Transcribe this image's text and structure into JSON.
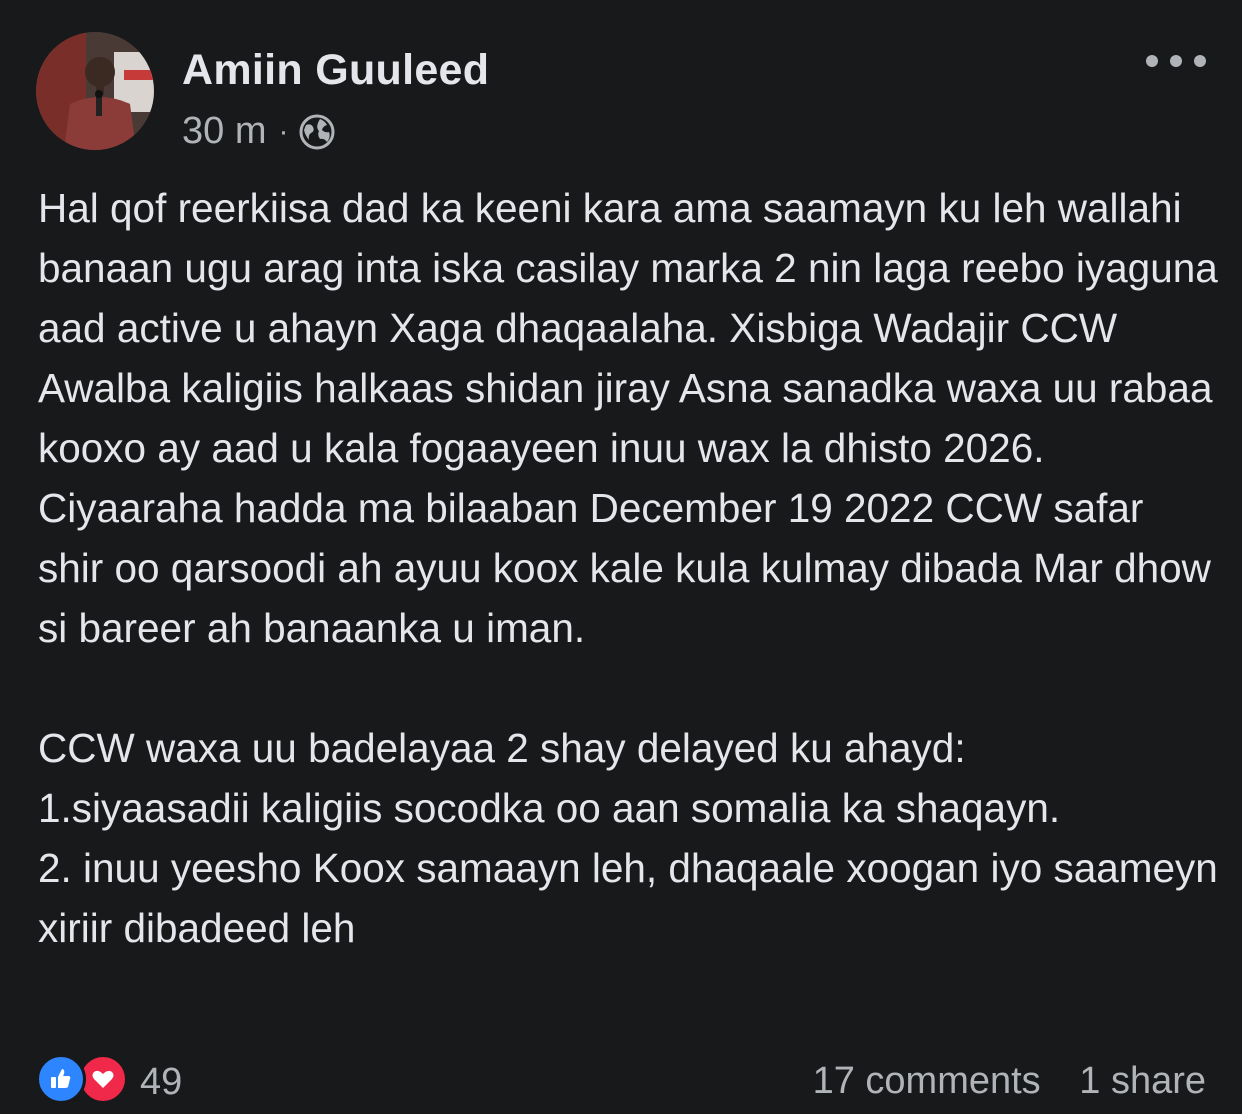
{
  "post": {
    "author": "Amiin Guuleed",
    "time": "30 m",
    "separator": "·",
    "privacy_icon": "globe-icon",
    "more_icon": "more-options-icon",
    "paragraphs": [
      "Hal qof reerkiisa dad ka keeni kara ama saamayn ku leh wallahi banaan ugu arag inta iska casilay marka 2 nin laga reebo iyaguna aad active u ahayn Xaga dhaqaalaha. Xisbiga Wadajir CCW Awalba kaligiis halkaas shidan jiray Asna sanadka waxa uu rabaa kooxo ay aad u kala fogaayeen inuu wax la dhisto 2026. Ciyaaraha  hadda ma bilaaban December 19 2022 CCW safar shir oo qarsoodi ah ayuu koox kale kula kulmay dibada Mar dhow si bareer ah banaanka u iman.",
      "CCW waxa uu badelayaa 2 shay delayed ku ahayd:",
      "1.siyaasadii kaligiis socodka oo aan somalia ka shaqayn.",
      "2. inuu yeesho Koox samaayn leh, dhaqaale xoogan iyo saameyn xiriir dibadeed leh"
    ]
  },
  "footer": {
    "reaction_count": "49",
    "comments": "17 comments",
    "shares": "1 share"
  },
  "colors": {
    "background": "#18191a",
    "text_primary": "#e4e6eb",
    "text_secondary": "#b0b3b8",
    "like_blue": "#2d86ff",
    "love_red": "#f02849"
  }
}
